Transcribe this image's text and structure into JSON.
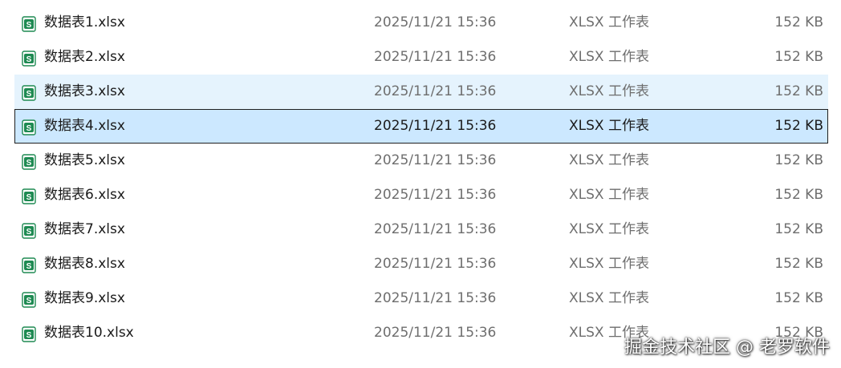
{
  "files": [
    {
      "name": "数据表1.xlsx",
      "modified": "2025/11/21 15:36",
      "type": "XLSX 工作表",
      "size": "152 KB",
      "state": "normal"
    },
    {
      "name": "数据表2.xlsx",
      "modified": "2025/11/21 15:36",
      "type": "XLSX 工作表",
      "size": "152 KB",
      "state": "normal"
    },
    {
      "name": "数据表3.xlsx",
      "modified": "2025/11/21 15:36",
      "type": "XLSX 工作表",
      "size": "152 KB",
      "state": "hover"
    },
    {
      "name": "数据表4.xlsx",
      "modified": "2025/11/21 15:36",
      "type": "XLSX 工作表",
      "size": "152 KB",
      "state": "selected"
    },
    {
      "name": "数据表5.xlsx",
      "modified": "2025/11/21 15:36",
      "type": "XLSX 工作表",
      "size": "152 KB",
      "state": "normal"
    },
    {
      "name": "数据表6.xlsx",
      "modified": "2025/11/21 15:36",
      "type": "XLSX 工作表",
      "size": "152 KB",
      "state": "normal"
    },
    {
      "name": "数据表7.xlsx",
      "modified": "2025/11/21 15:36",
      "type": "XLSX 工作表",
      "size": "152 KB",
      "state": "normal"
    },
    {
      "name": "数据表8.xlsx",
      "modified": "2025/11/21 15:36",
      "type": "XLSX 工作表",
      "size": "152 KB",
      "state": "normal"
    },
    {
      "name": "数据表9.xlsx",
      "modified": "2025/11/21 15:36",
      "type": "XLSX 工作表",
      "size": "152 KB",
      "state": "normal"
    },
    {
      "name": "数据表10.xlsx",
      "modified": "2025/11/21 15:36",
      "type": "XLSX 工作表",
      "size": "152 KB",
      "state": "normal"
    }
  ],
  "icon": {
    "name": "spreadsheet-file-icon",
    "letter": "S",
    "color": "#1e8a52"
  },
  "colors": {
    "hover": "#e5f3fd",
    "selected": "#cce8ff",
    "selected_border": "#1f1f1f"
  },
  "watermark": "掘金技术社区 @ 老罗软件"
}
